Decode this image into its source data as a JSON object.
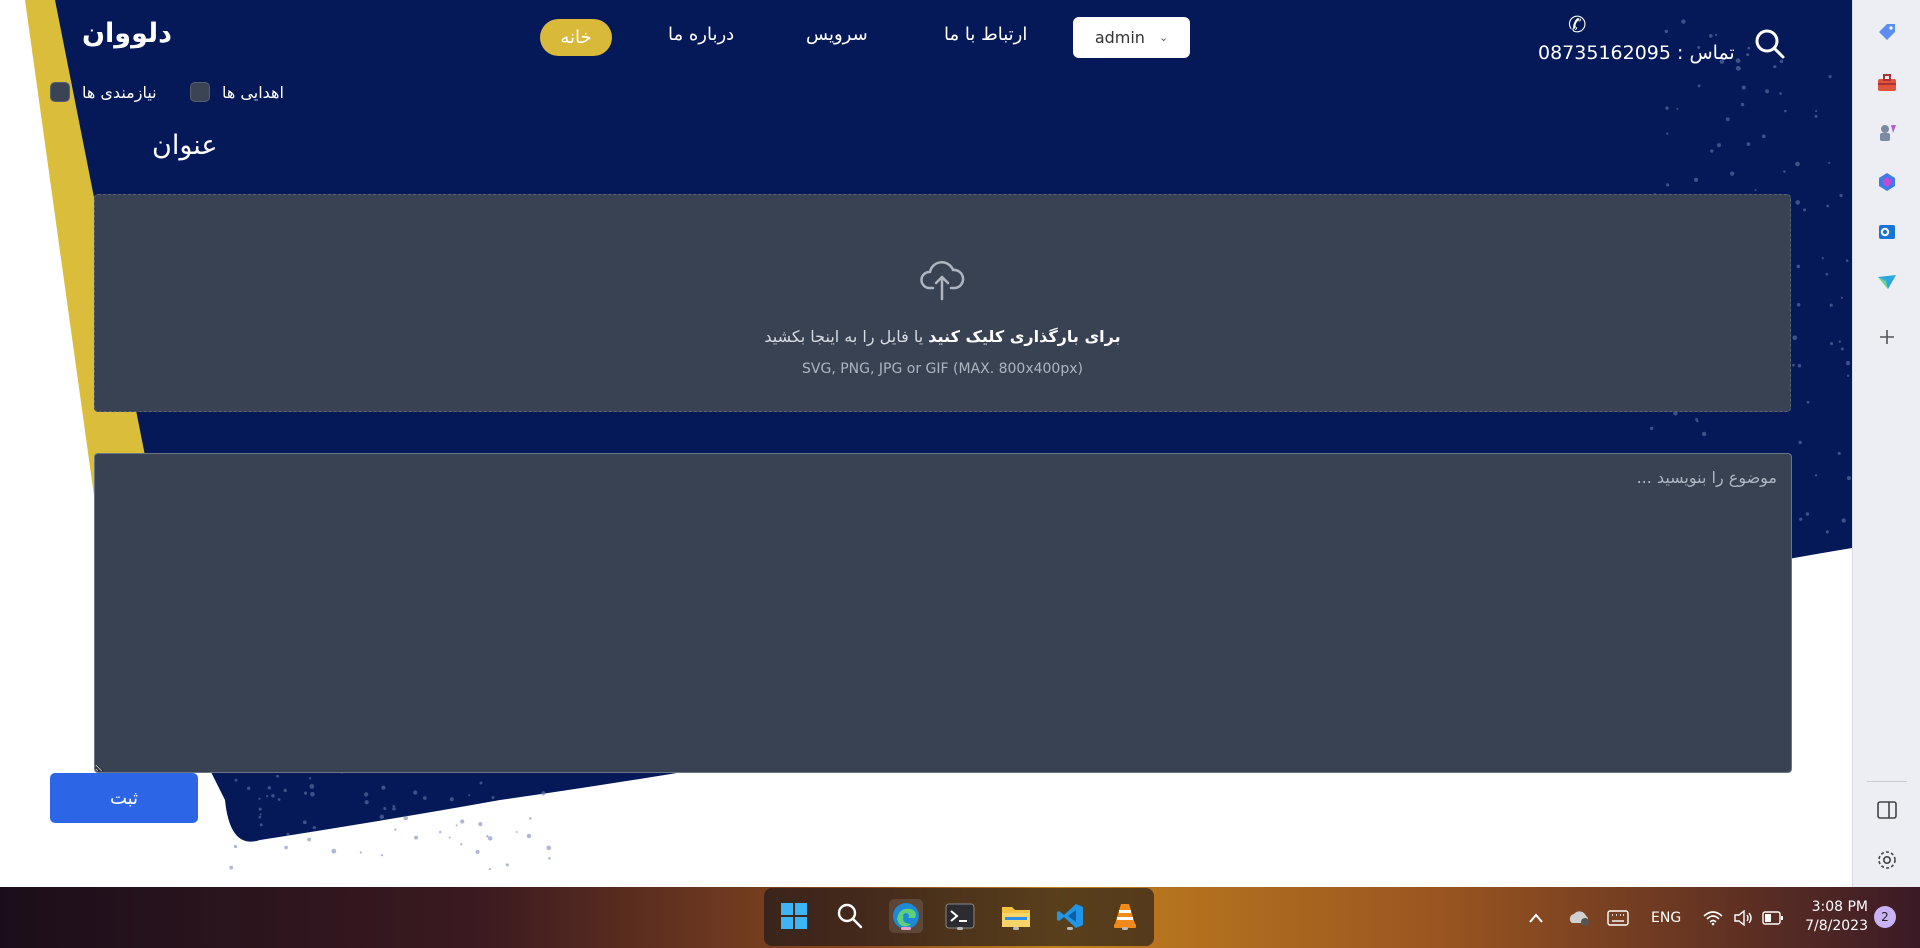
{
  "header": {
    "brand": "دلووان",
    "nav": {
      "home": "خانه",
      "about": "درباره ما",
      "service": "سرویس",
      "contact": "ارتباط با ما"
    },
    "user_select": "admin",
    "contact_text": "تماس : 08735162095",
    "icons": {
      "phone": "phone-icon",
      "search": "search-icon"
    }
  },
  "filters": {
    "donations": "اهدایی ها",
    "needs": "نیازمندی ها"
  },
  "form": {
    "title_label": "عنوان",
    "upload_bold": "برای بارگذاری کلیک کنید",
    "upload_rest": " یا فایل را به اینجا بکشید",
    "upload_hint": "SVG, PNG, JPG or GIF (MAX. 800x400px)",
    "subject_placeholder": "موضوع را بنویسید ...",
    "submit": "ثبت"
  },
  "sidebar_icons": [
    "tag-icon",
    "toolbox-icon",
    "games-icon",
    "copilot-icon",
    "outlook-icon",
    "send-icon",
    "add-icon",
    "split-view-icon",
    "settings-icon"
  ],
  "taskbar": {
    "apps": [
      "windows-start-icon",
      "search-icon",
      "edge-icon",
      "terminal-icon",
      "file-explorer-icon",
      "vscode-icon",
      "vlc-icon"
    ],
    "lang": "ENG",
    "time": "3:08 PM",
    "date": "7/8/2023",
    "notifications": "2"
  },
  "colors": {
    "background": "#051958",
    "accent_yellow": "#d9b93a",
    "panel": "#394253",
    "button": "#2c65e6"
  }
}
